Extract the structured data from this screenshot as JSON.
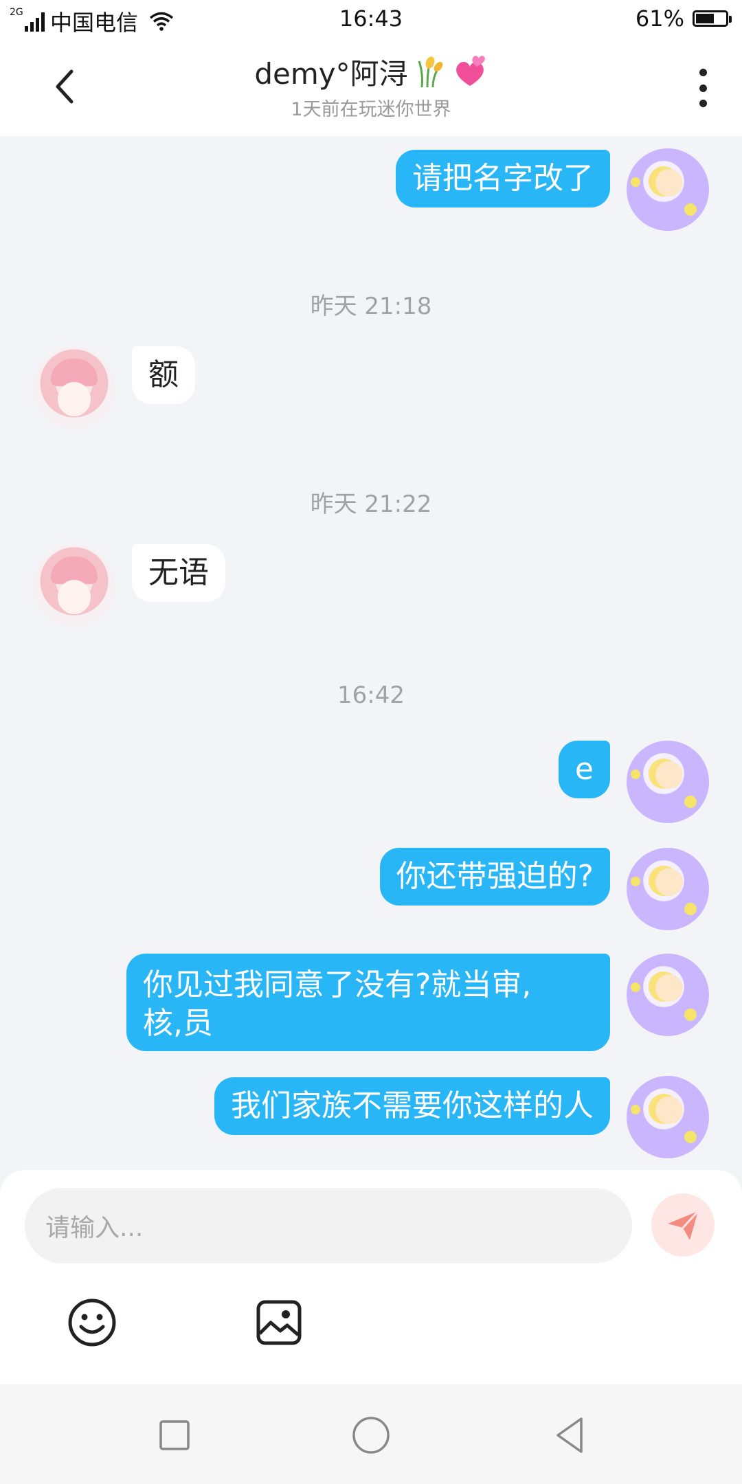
{
  "status_bar": {
    "network": "2G",
    "carrier": "中国电信",
    "time": "16:43",
    "battery_text": "61%",
    "battery_level": 0.61
  },
  "header": {
    "title": "demy°阿浔",
    "subtitle": "1天前在玩迷你世界",
    "title_emojis": [
      "rice-plant-icon",
      "two-hearts-icon"
    ]
  },
  "messages": [
    {
      "type": "sent",
      "text": "请把名字改了"
    },
    {
      "type": "time",
      "text": "昨天 21:18"
    },
    {
      "type": "received",
      "text": "额"
    },
    {
      "type": "time",
      "text": "昨天 21:22"
    },
    {
      "type": "received",
      "text": "无语"
    },
    {
      "type": "time",
      "text": "16:42"
    },
    {
      "type": "sent",
      "text": "e"
    },
    {
      "type": "sent",
      "text": "你还带强迫的?"
    },
    {
      "type": "sent",
      "text": "你见过我同意了没有?就当审,\n核,员"
    },
    {
      "type": "sent",
      "text": "我们家族不需要你这样的人"
    }
  ],
  "input": {
    "placeholder": "请输入..."
  },
  "colors": {
    "sent_bubble": "#29b6f6",
    "received_bubble": "#ffffff",
    "background": "#f3f4f8",
    "send_button": "#f48b7f"
  }
}
